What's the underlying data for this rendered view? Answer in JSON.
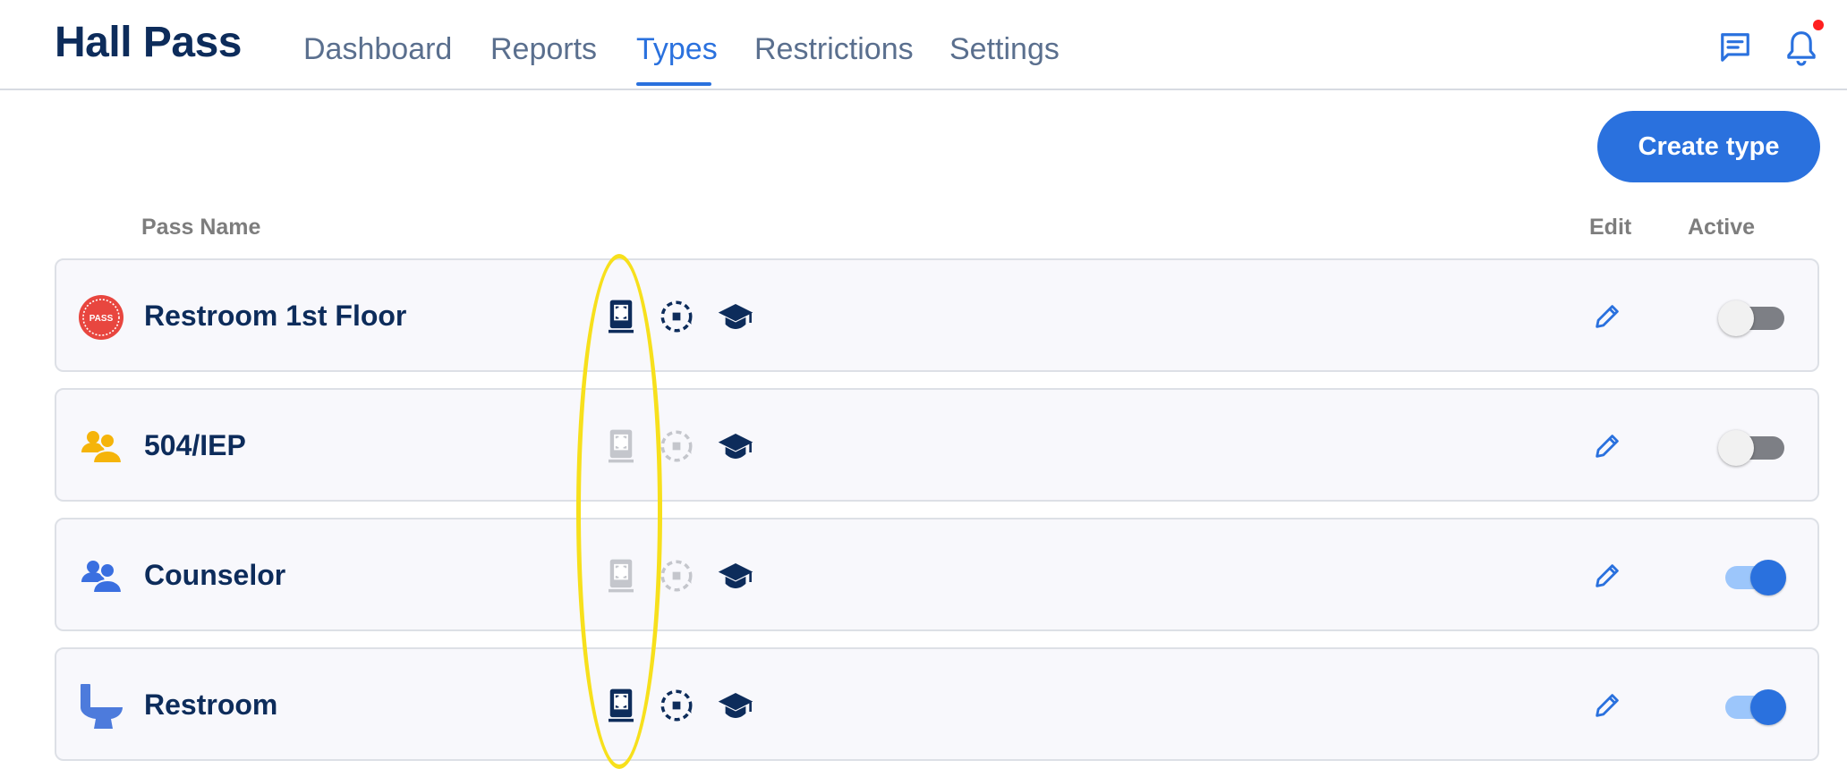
{
  "app": {
    "title": "Hall Pass"
  },
  "nav": [
    {
      "label": "Dashboard",
      "active": false
    },
    {
      "label": "Reports",
      "active": false
    },
    {
      "label": "Types",
      "active": true
    },
    {
      "label": "Restrictions",
      "active": false
    },
    {
      "label": "Settings",
      "active": false
    }
  ],
  "header_icons": [
    "message-icon",
    "bell-icon"
  ],
  "notification_dot": true,
  "actions": {
    "create_label": "Create type"
  },
  "columns": {
    "name": "Pass Name",
    "edit": "Edit",
    "active": "Active"
  },
  "rows": [
    {
      "name": "Restroom 1st Floor",
      "icon": "pass-badge-icon",
      "kiosk_enabled": true,
      "loop_enabled": true,
      "teacher_enabled": true,
      "active": false
    },
    {
      "name": "504/IEP",
      "icon": "group-icon-yellow",
      "kiosk_enabled": false,
      "loop_enabled": false,
      "teacher_enabled": true,
      "active": false
    },
    {
      "name": "Counselor",
      "icon": "group-icon-blue",
      "kiosk_enabled": false,
      "loop_enabled": false,
      "teacher_enabled": true,
      "active": true
    },
    {
      "name": "Restroom",
      "icon": "toilet-icon",
      "kiosk_enabled": true,
      "loop_enabled": true,
      "teacher_enabled": true,
      "active": true
    }
  ],
  "colors": {
    "brand": "#0d2c5b",
    "accent": "#2a71de",
    "highlight": "#f7e01c",
    "nav_inactive": "#5a6f8e",
    "disabled_icon": "#c4c6cc"
  }
}
